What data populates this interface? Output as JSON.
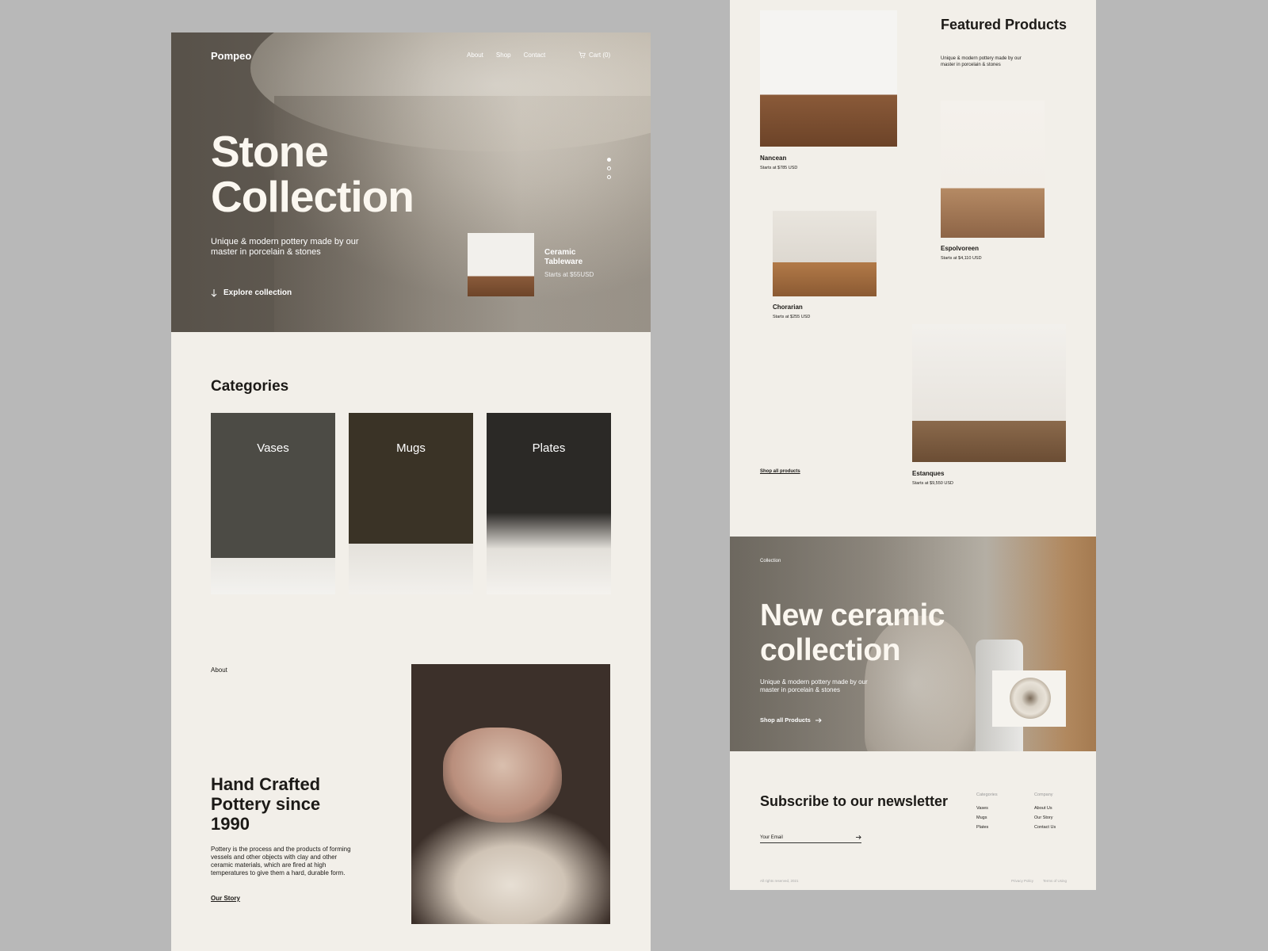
{
  "brand": "Pompeo",
  "nav": {
    "about": "About",
    "shop": "Shop",
    "contact": "Contact",
    "cart": "Cart (0)"
  },
  "hero": {
    "title_line1": "Stone",
    "title_line2": "Collection",
    "subtitle": "Unique & modern pottery made by our master in porcelain & stones",
    "cta": "Explore collection",
    "feature_name": "Ceramic Tableware",
    "feature_price": "Starts at $55USD",
    "slide_count": 3,
    "active_slide": 1
  },
  "categories": {
    "title": "Categories",
    "items": [
      {
        "label": "Vases"
      },
      {
        "label": "Mugs"
      },
      {
        "label": "Plates"
      }
    ]
  },
  "about": {
    "tag": "About",
    "title": "Hand Crafted Pottery since 1990",
    "text": "Pottery is the process and the products of forming vessels and other objects with clay and other ceramic materials, which are fired at high temperatures to give them a hard, durable form.",
    "link": "Our Story"
  },
  "featured": {
    "title": "Featured Products",
    "subtitle": "Unique & modern pottery made by our master in porcelain & stones",
    "products": [
      {
        "name": "Nancean",
        "price": "Starts at $785 USD"
      },
      {
        "name": "Espolvoreen",
        "price": "Starts at $4,110 USD"
      },
      {
        "name": "Chorarian",
        "price": "Starts at $255 USD"
      },
      {
        "name": "Estanques",
        "price": "Starts at $9,550 USD"
      }
    ],
    "shop_all": "Shop all products"
  },
  "banner": {
    "tag": "Collection",
    "title": "New ceramic collection",
    "subtitle": "Unique & modern pottery made by our master in porcelain & stones",
    "cta": "Shop all Products"
  },
  "newsletter": {
    "title": "Subscribe to our newsletter",
    "placeholder": "Your Email"
  },
  "footer": {
    "categories_heading": "Categories",
    "categories": [
      "Vases",
      "Mugs",
      "Plates"
    ],
    "company_heading": "Company",
    "company": [
      "About Us",
      "Our Story",
      "Contact Us"
    ],
    "copyright": "All rights reserved, 2021",
    "privacy": "Privacy Policy",
    "terms": "Terms of Using"
  },
  "colors": {
    "page_bg": "#b8b8b8",
    "card_bg": "#f2efe9",
    "text": "#1c1a17",
    "hero_text": "#fbf7f0"
  },
  "icons": [
    "cart-icon",
    "arrow-down-icon",
    "arrow-right-icon"
  ]
}
